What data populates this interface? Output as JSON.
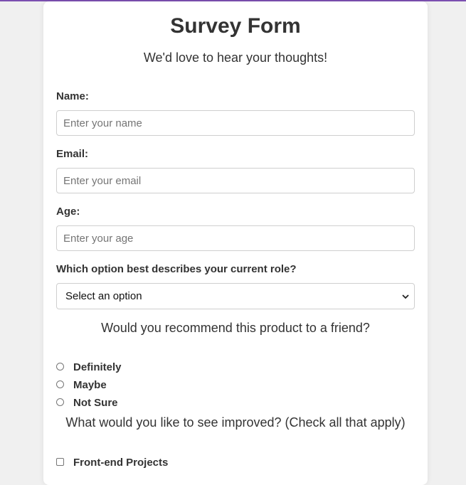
{
  "form": {
    "title": "Survey Form",
    "subtitle": "We'd love to hear your thoughts!",
    "name": {
      "label": "Name:",
      "placeholder": "Enter your name"
    },
    "email": {
      "label": "Email:",
      "placeholder": "Enter your email"
    },
    "age": {
      "label": "Age:",
      "placeholder": "Enter your age"
    },
    "role": {
      "label": "Which option best describes your current role?",
      "selected": "Select an option"
    },
    "recommend": {
      "question": "Would you recommend this product to a friend?",
      "options": [
        "Definitely",
        "Maybe",
        "Not Sure"
      ]
    },
    "improve": {
      "question": "What would you like to see improved? (Check all that apply)",
      "options": [
        "Front-end Projects"
      ]
    }
  },
  "colors": {
    "accent_bar": "#7b4fb0",
    "background": "#f0f0f0",
    "card": "#ffffff"
  }
}
